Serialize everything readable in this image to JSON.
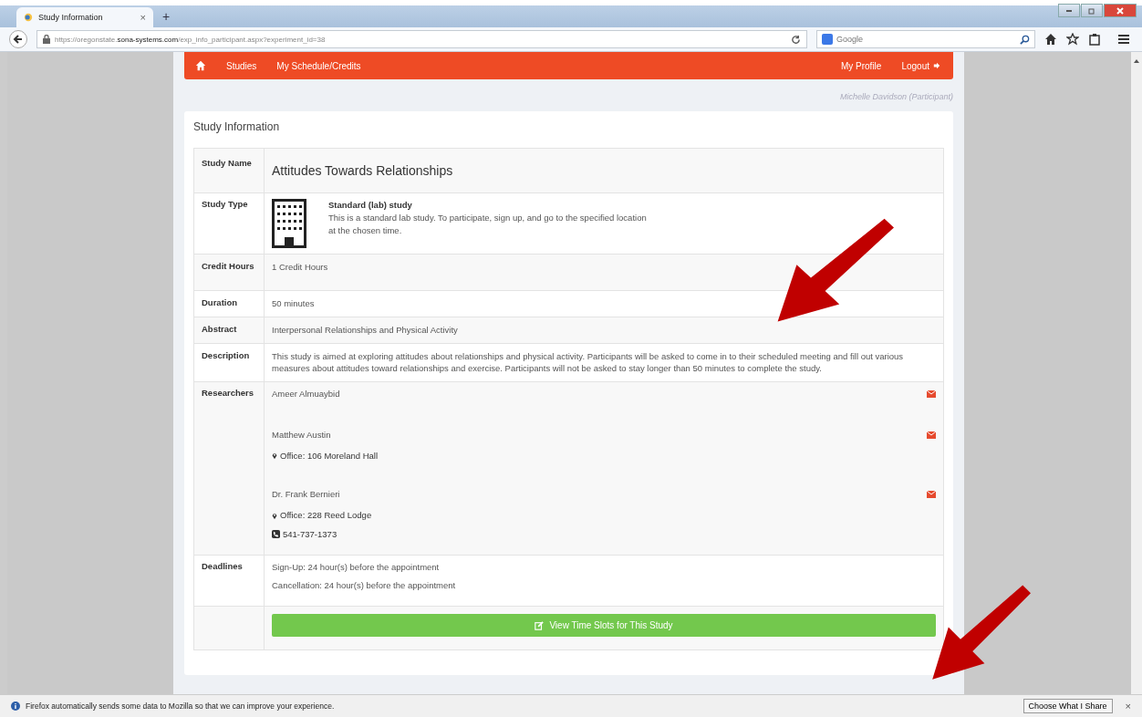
{
  "browser": {
    "tab": {
      "title": "Study Information",
      "close": "×",
      "selected": true
    },
    "new_tab": "+",
    "url": "https://oregonstate.**sona-systems.com**/exp_info_participant.aspx?experiment_id=38",
    "search": {
      "placeholder": "Google"
    }
  },
  "nav": {
    "items": [
      {
        "label": "Studies"
      },
      {
        "label": "My Schedule/Credits"
      }
    ],
    "right_items": [
      {
        "label": "My Profile",
        "kind": "link"
      },
      {
        "label": "Logout",
        "kind": "logout"
      }
    ]
  },
  "user": "Michelle Davidson (Participant)",
  "card": {
    "title": "Study Information",
    "rows": [
      {
        "label": "Study Name",
        "kind": "title",
        "value": "Attitudes Towards Relationships"
      },
      {
        "label": "Study Type",
        "kind": "type",
        "heading": "Standard (lab) study",
        "value": "This is a standard lab study. To participate, sign up, and go to the specified location at the chosen time."
      },
      {
        "label": "Credit Hours",
        "kind": "text",
        "value": "1 Credit Hours"
      },
      {
        "label": "Duration",
        "kind": "text",
        "value": "50 minutes"
      },
      {
        "label": "Abstract",
        "kind": "text",
        "value": "Interpersonal Relationships and Physical Activity"
      },
      {
        "label": "Description",
        "kind": "text",
        "value": "This study is aimed at exploring attitudes about relationships and physical activity. Participants will be asked to come in to their scheduled meeting and fill out various measures about attitudes toward relationships and exercise. Participants will not be asked to stay longer than 50 minutes to complete the study."
      },
      {
        "label": "Researchers",
        "kind": "researchers",
        "researchers": [
          {
            "name": "Ameer Almuaybid"
          },
          {
            "name": "Matthew Austin",
            "office": "Office: 106 Moreland Hall"
          },
          {
            "name": "Dr. Frank Bernieri",
            "office": "Office: 228 Reed Lodge",
            "phone": "541-737-1373"
          }
        ]
      },
      {
        "label": "Deadlines",
        "kind": "deadlines",
        "lines": [
          "Sign-Up:  24 hour(s) before the appointment",
          "Cancellation:  24 hour(s) before the appointment"
        ]
      },
      {
        "label": "",
        "kind": "action",
        "button": "View Time Slots for This Study"
      }
    ]
  },
  "annotations": [
    {
      "kind": "arrow"
    },
    {
      "kind": "arrow"
    }
  ],
  "notification": {
    "text": "Firefox automatically sends some data to Mozilla so that we can improve your experience.",
    "button": "Choose What I Share",
    "close": "×"
  }
}
